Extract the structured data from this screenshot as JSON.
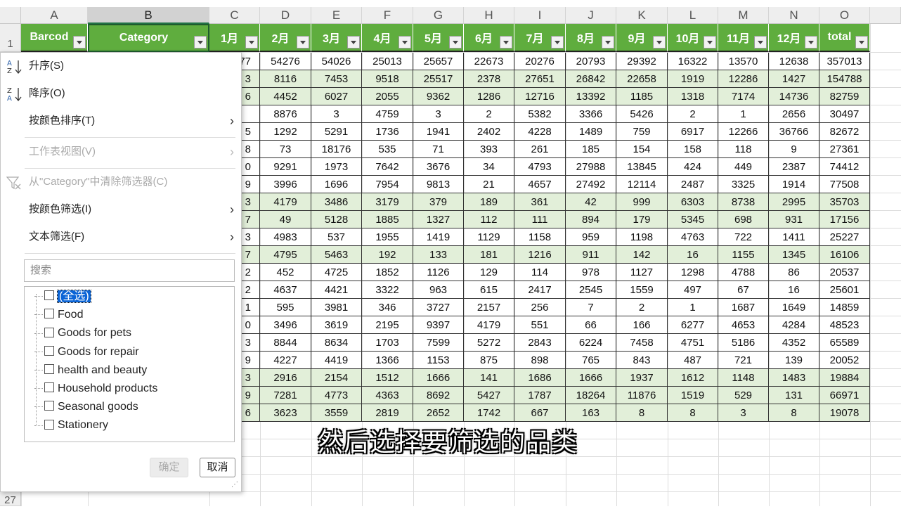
{
  "columns": [
    "A",
    "B",
    "C",
    "D",
    "E",
    "F",
    "G",
    "H",
    "I",
    "J",
    "K",
    "L",
    "M",
    "N",
    "O"
  ],
  "headers": [
    "Barcod",
    "Category",
    "1月",
    "2月",
    "3月",
    "4月",
    "5月",
    "6月",
    "7月",
    "8月",
    "9月",
    "10月",
    "11月",
    "12月",
    "total"
  ],
  "row_numbers": {
    "first": "1",
    "last": "27"
  },
  "rows": [
    {
      "c": "77",
      "v": [
        "54276",
        "54026",
        "25013",
        "25657",
        "22673",
        "20276",
        "20793",
        "29392",
        "16322",
        "13570",
        "12638",
        "357013"
      ]
    },
    {
      "c": "3",
      "v": [
        "8116",
        "7453",
        "9518",
        "25517",
        "2378",
        "27651",
        "26842",
        "22658",
        "1919",
        "12286",
        "1427",
        "154788"
      ]
    },
    {
      "c": "6",
      "v": [
        "4452",
        "6027",
        "2055",
        "9362",
        "1286",
        "12716",
        "13392",
        "1185",
        "1318",
        "7174",
        "14736",
        "82759"
      ]
    },
    {
      "c": "",
      "v": [
        "8876",
        "3",
        "4759",
        "3",
        "2",
        "5382",
        "3366",
        "5426",
        "2",
        "1",
        "2656",
        "30497"
      ]
    },
    {
      "c": "5",
      "v": [
        "1292",
        "5291",
        "1736",
        "1941",
        "2402",
        "4228",
        "1489",
        "759",
        "6917",
        "12266",
        "36766",
        "82672"
      ]
    },
    {
      "c": "8",
      "v": [
        "73",
        "18176",
        "535",
        "71",
        "393",
        "261",
        "185",
        "154",
        "158",
        "118",
        "9",
        "27361"
      ]
    },
    {
      "c": "0",
      "v": [
        "9291",
        "1973",
        "7642",
        "3676",
        "34",
        "4793",
        "27988",
        "13845",
        "424",
        "449",
        "2387",
        "74412"
      ]
    },
    {
      "c": "9",
      "v": [
        "3996",
        "1696",
        "7954",
        "9813",
        "21",
        "4657",
        "27492",
        "12114",
        "2487",
        "3325",
        "1914",
        "77508"
      ]
    },
    {
      "c": "3",
      "v": [
        "4179",
        "3486",
        "3179",
        "379",
        "189",
        "361",
        "42",
        "999",
        "6303",
        "8738",
        "2995",
        "35703"
      ]
    },
    {
      "c": "7",
      "v": [
        "49",
        "5128",
        "1885",
        "1327",
        "112",
        "111",
        "894",
        "179",
        "5345",
        "698",
        "931",
        "17156"
      ]
    },
    {
      "c": "3",
      "v": [
        "4983",
        "537",
        "1955",
        "1419",
        "1129",
        "1158",
        "959",
        "1198",
        "4763",
        "722",
        "1411",
        "25227"
      ]
    },
    {
      "c": "7",
      "v": [
        "4795",
        "5463",
        "192",
        "133",
        "181",
        "1216",
        "911",
        "142",
        "16",
        "1155",
        "1345",
        "16106"
      ]
    },
    {
      "c": "2",
      "v": [
        "452",
        "4725",
        "1852",
        "1126",
        "129",
        "114",
        "978",
        "1127",
        "1298",
        "4788",
        "86",
        "20537"
      ]
    },
    {
      "c": "2",
      "v": [
        "4637",
        "4421",
        "3322",
        "963",
        "615",
        "2417",
        "2545",
        "1559",
        "497",
        "67",
        "16",
        "25601"
      ]
    },
    {
      "c": "1",
      "v": [
        "595",
        "3981",
        "346",
        "3727",
        "2157",
        "256",
        "7",
        "2",
        "1",
        "1687",
        "1649",
        "14859"
      ]
    },
    {
      "c": "0",
      "v": [
        "3496",
        "3619",
        "2195",
        "9397",
        "4179",
        "551",
        "66",
        "166",
        "6277",
        "4653",
        "4284",
        "48523"
      ]
    },
    {
      "c": "3",
      "v": [
        "8844",
        "8634",
        "1703",
        "7599",
        "5272",
        "2843",
        "6224",
        "7458",
        "4751",
        "5186",
        "4352",
        "65589"
      ]
    },
    {
      "c": "9",
      "v": [
        "4227",
        "4419",
        "1366",
        "1153",
        "875",
        "898",
        "765",
        "843",
        "487",
        "721",
        "139",
        "20052"
      ]
    },
    {
      "c": "3",
      "v": [
        "2916",
        "2154",
        "1512",
        "1666",
        "141",
        "1686",
        "1666",
        "1937",
        "1612",
        "1148",
        "1483",
        "19884"
      ]
    },
    {
      "c": "9",
      "v": [
        "7281",
        "4773",
        "4363",
        "8692",
        "5427",
        "1787",
        "18264",
        "11876",
        "1519",
        "529",
        "131",
        "66971"
      ]
    },
    {
      "c": "6",
      "v": [
        "3623",
        "3559",
        "2819",
        "2652",
        "1742",
        "667",
        "163",
        "8",
        "8",
        "3",
        "8",
        "19078"
      ]
    }
  ],
  "alt_rows": [
    1,
    2,
    8,
    9,
    11,
    18,
    19,
    20
  ],
  "colors": {
    "header_green": "#5fad3e",
    "alt_row": "#e2efd9",
    "selection_blue": "#0a64d6"
  },
  "subtitle": "然后选择要筛选的品类",
  "menu": {
    "sort_asc": "升序(S)",
    "sort_desc": "降序(O)",
    "sort_by_color": "按颜色排序(T)",
    "sheet_view": "工作表视图(V)",
    "clear_filter": "从\"Category\"中清除筛选器(C)",
    "filter_by_color": "按颜色筛选(I)",
    "text_filter": "文本筛选(F)",
    "search_placeholder": "搜索",
    "items": [
      "(全选)",
      "Food",
      "Goods for pets",
      "Goods for repair",
      "health and beauty",
      "Household products",
      "Seasonal goods",
      "Stationery"
    ],
    "ok": "确定",
    "cancel": "取消"
  }
}
